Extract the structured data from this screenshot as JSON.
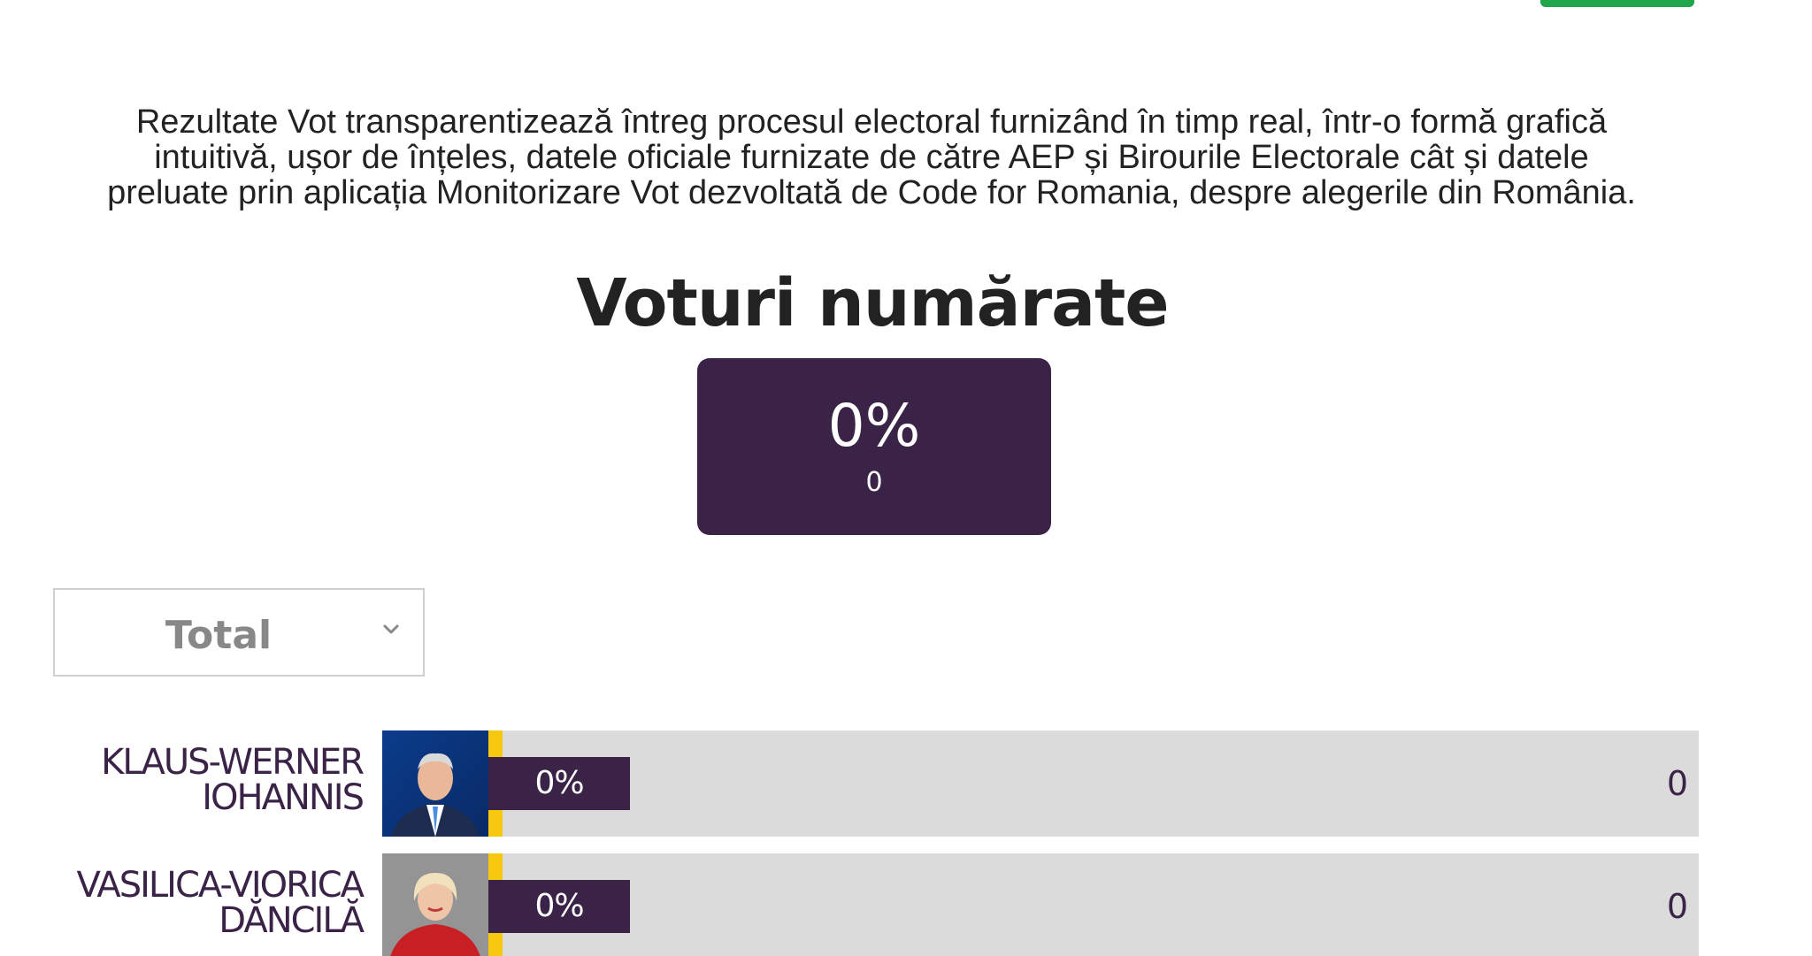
{
  "intro": {
    "line1": "Rezultate Vot transparentizează întreg procesul electoral furnizând în timp real, într-o formă grafică",
    "line2": "intuitivă, ușor de înțeles, datele oficiale furnizate de către AEP și Birourile Electorale cât și datele",
    "line3": "preluate prin aplicația Monitorizare Vot dezvoltată de Code for Romania, despre alegerile din România."
  },
  "counted": {
    "title": "Voturi numărate",
    "percent": "0%",
    "count": "0"
  },
  "filter": {
    "selected": "Total",
    "icon": "chevron-down-icon"
  },
  "colors": {
    "accent": "#3a2347",
    "track": "#dbdbdb",
    "party_stripe": "#f6c90e",
    "top_button": "#1fa54a"
  },
  "candidates": [
    {
      "name_line1": "KLAUS-WERNER",
      "name_line2": "IOHANNIS",
      "percent_label": "0%",
      "percent": 0,
      "votes": "0",
      "photo": "candidate-photo-iohannis"
    },
    {
      "name_line1": "VASILICA-VIORICA",
      "name_line2": "DĂNCILĂ",
      "percent_label": "0%",
      "percent": 0,
      "votes": "0",
      "photo": "candidate-photo-dancila"
    }
  ]
}
